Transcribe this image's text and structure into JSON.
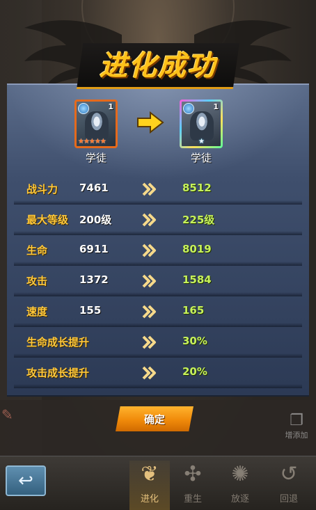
{
  "title": "进化成功",
  "before_card": {
    "name": "学徒",
    "level": "1",
    "stars": "★★★★★"
  },
  "after_card": {
    "name": "学徒",
    "level": "1",
    "stars": "★"
  },
  "stats": [
    {
      "label": "战斗力",
      "old": "7461",
      "new": "8512"
    },
    {
      "label": "最大等级",
      "old": "200级",
      "new": "225级"
    },
    {
      "label": "生命",
      "old": "6911",
      "new": "8019"
    },
    {
      "label": "攻击",
      "old": "1372",
      "new": "1584"
    },
    {
      "label": "速度",
      "old": "155",
      "new": "165"
    },
    {
      "label": "生命成长提升",
      "old": "",
      "new": "30%"
    },
    {
      "label": "攻击成长提升",
      "old": "",
      "new": "20%"
    }
  ],
  "confirm_label": "确定",
  "side_add_label": "增添加",
  "bottom_tabs": [
    {
      "label": "进化",
      "icon": "wing-icon",
      "active": true
    },
    {
      "label": "重生",
      "icon": "rebirth-icon",
      "active": false
    },
    {
      "label": "放逐",
      "icon": "exile-icon",
      "active": false
    },
    {
      "label": "回退",
      "icon": "rollback-icon",
      "active": false
    }
  ],
  "colors": {
    "title": "#ffc21a",
    "stat_label": "#ffc83a",
    "stat_new": "#c6f15a",
    "button": "#f08a0a",
    "panel": "#3f4f6d"
  }
}
